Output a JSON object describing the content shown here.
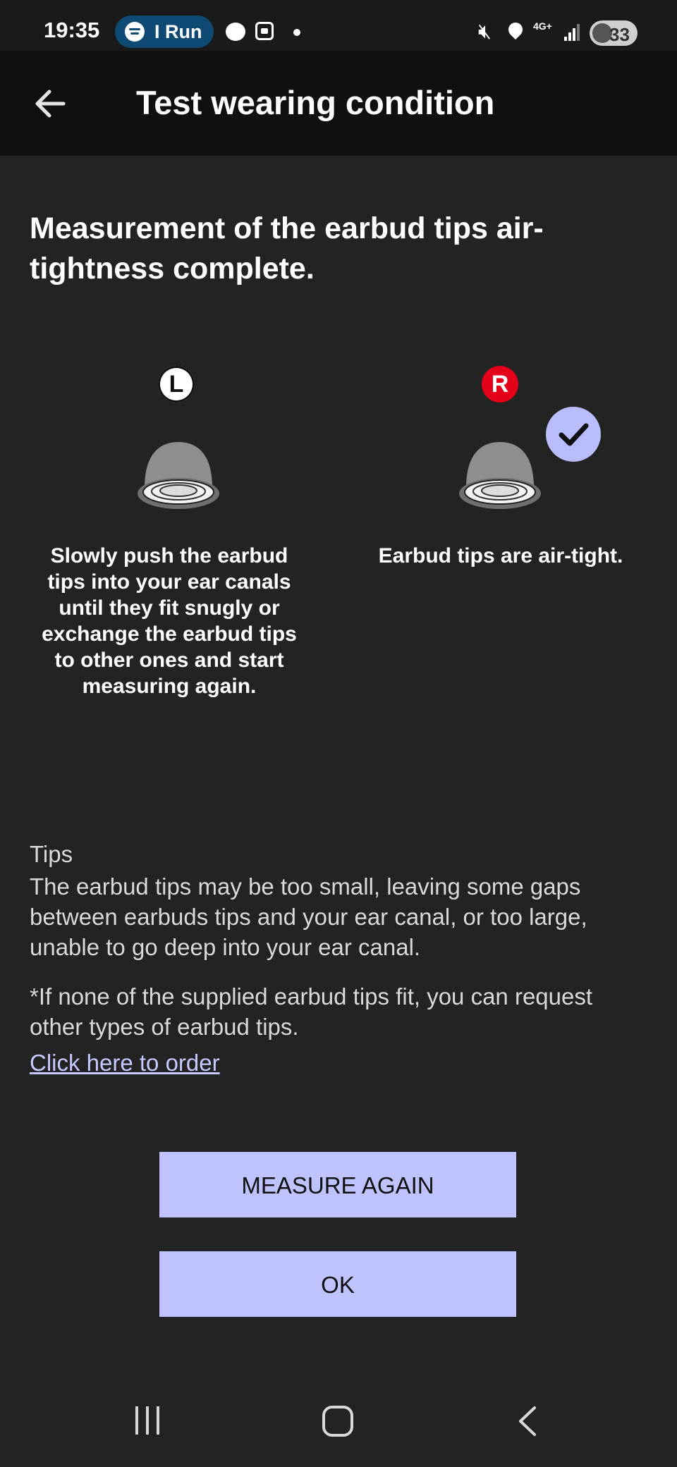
{
  "status_bar": {
    "time": "19:35",
    "spotify_label": "I Run",
    "network": "4G+",
    "battery": "33"
  },
  "app_bar": {
    "title": "Test wearing condition",
    "back_icon": "back-arrow-icon"
  },
  "headline": "Measurement of the earbud tips air-tightness complete.",
  "earbuds": {
    "left": {
      "badge": "L",
      "status": "Slowly push the earbud tips into your ear canals until they fit snugly or exchange the earbud tips to other ones and start measuring again."
    },
    "right": {
      "badge": "R",
      "status": "Earbud tips are air-tight.",
      "check_icon": "check-circle-icon"
    }
  },
  "tips": {
    "title": "Tips",
    "body": "The earbud tips may be too small, leaving some gaps between earbuds tips and your ear canal, or too large, unable to go deep into your ear canal.",
    "note": "*If none of the supplied earbud tips fit, you can request other types of earbud tips.",
    "link": "Click here to order"
  },
  "buttons": {
    "measure_again": "MEASURE AGAIN",
    "ok": "OK"
  },
  "colors": {
    "accent": "#bfc3ff",
    "background": "#232323",
    "app_bar": "#101010",
    "right_badge": "#e5001a",
    "link": "#c5c9ff"
  }
}
